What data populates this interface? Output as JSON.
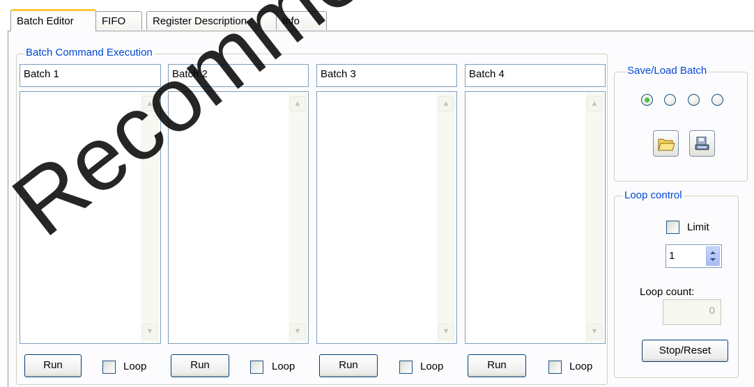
{
  "tabs": [
    {
      "label": "Batch Editor",
      "active": true
    },
    {
      "label": "FIFO",
      "active": false
    },
    {
      "label": "Register Description",
      "active": false
    },
    {
      "label": "Info",
      "active": false
    }
  ],
  "batch_group": {
    "title": "Batch Command Execution",
    "batches": [
      {
        "name": "Batch 1",
        "run_label": "Run",
        "loop_label": "Loop",
        "loop_checked": false
      },
      {
        "name": "Batch 2",
        "run_label": "Run",
        "loop_label": "Loop",
        "loop_checked": false
      },
      {
        "name": "Batch 3",
        "run_label": "Run",
        "loop_label": "Loop",
        "loop_checked": false
      },
      {
        "name": "Batch 4",
        "run_label": "Run",
        "loop_label": "Loop",
        "loop_checked": false
      }
    ]
  },
  "save_load": {
    "title": "Save/Load Batch",
    "slots": 4,
    "selected_slot": 1,
    "open_icon": "folder-open-icon",
    "save_icon": "save-disk-icon"
  },
  "loop_control": {
    "title": "Loop control",
    "limit_label": "Limit",
    "limit_checked": false,
    "limit_value": "1",
    "count_label": "Loop count:",
    "count_value": "0",
    "stop_label": "Stop/Reset"
  },
  "watermark": "Recommended",
  "colors": {
    "group_title": "#0046d5",
    "active_tab_accent": "#ffc83c",
    "panel_bg": "#fcfcfe"
  }
}
